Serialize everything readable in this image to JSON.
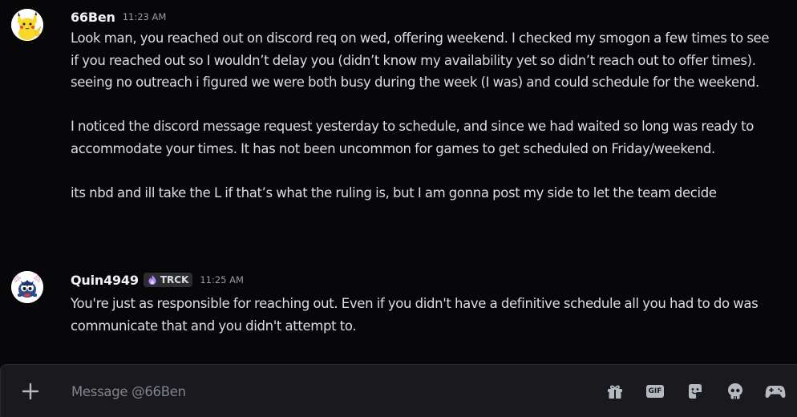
{
  "messages": [
    {
      "author": "66Ben",
      "timestamp": "11:23 AM",
      "avatar_icon": "pikachu-avatar",
      "paragraphs": [
        "Look man, you reached out on discord req on wed, offering weekend. I checked my smogon a few times to see if you reached out so I wouldn’t delay you (didn’t know my availability yet so didn’t reach out to offer times). seeing no outreach i figured we were both busy during the week (I was) and could schedule for the weekend.",
        "I noticed the discord message request yesterday to schedule, and since we had waited so long was ready to accommodate your times. It has not been uncommon for games to get scheduled on Friday/weekend.",
        "its nbd and ill take the L if that’s what the ruling is, but I am gonna post my side to let the team decide"
      ]
    },
    {
      "author": "Quin4949",
      "tag": "TRCK",
      "timestamp": "11:25 AM",
      "avatar_icon": "pokemon-avatar",
      "paragraphs": [
        "You're just as responsible for reaching out. Even if you didn't have a definitive schedule all you had to do was communicate that and you didn't attempt to."
      ]
    }
  ],
  "composer": {
    "placeholder": "Message @66Ben",
    "value": "",
    "gif_label": "GIF",
    "icons": [
      "plus-icon",
      "gift-icon",
      "gif-icon",
      "sticker-icon",
      "emoji-icon",
      "gamepad-icon"
    ]
  },
  "colors": {
    "background": "#070709",
    "composer_bg": "#1a1a1e",
    "text": "#dbdee1",
    "username": "#f2f3f5",
    "timestamp": "#949ba4",
    "tag_bg": "#2b2d31",
    "icon": "#b5bac1",
    "tag_accent": "#b389ff"
  }
}
